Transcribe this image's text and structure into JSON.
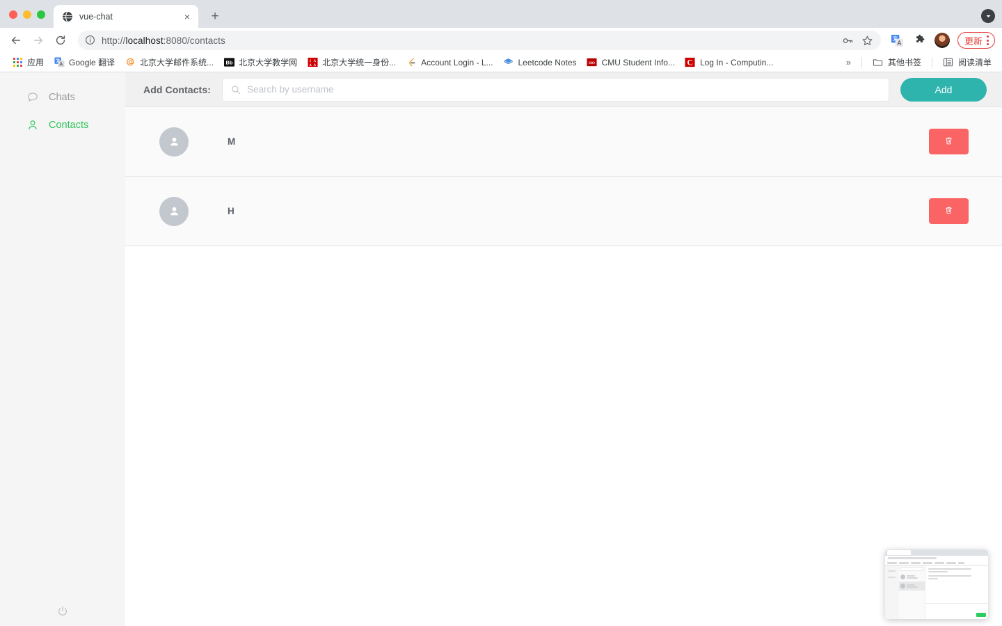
{
  "browser": {
    "tab": {
      "title": "vue-chat",
      "favicon": "globe-icon",
      "close_label": "×"
    },
    "new_tab_label": "+",
    "omnibox": {
      "url_prefix": "http://",
      "url_host": "localhost",
      "url_suffix": ":8080/contacts",
      "full_url": "http://localhost:8080/contacts",
      "info_icon": "info-circle-icon",
      "password_icon": "key-icon",
      "bookmark_icon": "star-icon"
    },
    "toolbar_icons": [
      "translate-icon",
      "extensions-puzzle-icon",
      "profile-avatar"
    ],
    "update_button": {
      "label": "更新",
      "color": "#e53935"
    },
    "menu_icon": "kebab-menu-icon",
    "tab_search_icon": "chevron-down-circle-icon",
    "bookmarks": [
      {
        "label": "应用",
        "icon": "apps-grid-icon"
      },
      {
        "label": "Google 翻译",
        "icon": "google-translate-icon"
      },
      {
        "label": "北京大学邮件系统...",
        "icon": "at-sign-icon"
      },
      {
        "label": "北京大学教学网",
        "icon": "blackboard-icon"
      },
      {
        "label": "北京大学统一身份...",
        "icon": "iaaa-icon"
      },
      {
        "label": "Account Login - L...",
        "icon": "leetcode-icon"
      },
      {
        "label": "Leetcode Notes",
        "icon": "notes-book-icon"
      },
      {
        "label": "CMU Student Info...",
        "icon": "sio-icon"
      },
      {
        "label": "Log In - Computin...",
        "icon": "cmu-c-icon"
      }
    ],
    "overflow_label": "»",
    "other_bookmarks": {
      "label": "其他书签",
      "icon": "folder-icon"
    },
    "reading_list": {
      "label": "阅读清单",
      "icon": "reading-list-icon"
    }
  },
  "app": {
    "sidebar": {
      "items": [
        {
          "label": "Chats",
          "icon": "chat-bubble-icon",
          "active": false
        },
        {
          "label": "Contacts",
          "icon": "person-icon",
          "active": true
        }
      ],
      "logout_icon": "power-icon",
      "active_color": "#2fc55c"
    },
    "header": {
      "add_contacts_label": "Add Contacts:",
      "search": {
        "value": "",
        "placeholder": "Search by username",
        "icon": "search-icon"
      },
      "add_button": {
        "label": "Add",
        "color": "#2fb3ad"
      }
    },
    "contacts": [
      {
        "name": "M",
        "avatar_icon": "person-avatar-icon",
        "delete_icon": "trash-icon"
      },
      {
        "name": "H",
        "avatar_icon": "person-avatar-icon",
        "delete_icon": "trash-icon"
      }
    ],
    "delete_button_color": "#fa6465"
  },
  "pip": {
    "name": "picture-in-picture-preview"
  }
}
